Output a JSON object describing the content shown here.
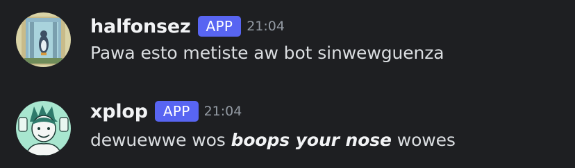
{
  "messages": [
    {
      "username": "halfonsez",
      "badge": "APP",
      "timestamp": "21:04",
      "content": "Pawa esto metiste aw bot sinwewguenza"
    },
    {
      "username": "xplop",
      "badge": "APP",
      "timestamp": "21:04",
      "content_before": "dewuewwe wos ",
      "content_emphasis": "boops your nose",
      "content_after": " wowes"
    }
  ],
  "colors": {
    "background": "#1e1f22",
    "username": "#f2f3f5",
    "badge": "#5865f2",
    "timestamp": "#949ba4",
    "text": "#dbdee1"
  }
}
